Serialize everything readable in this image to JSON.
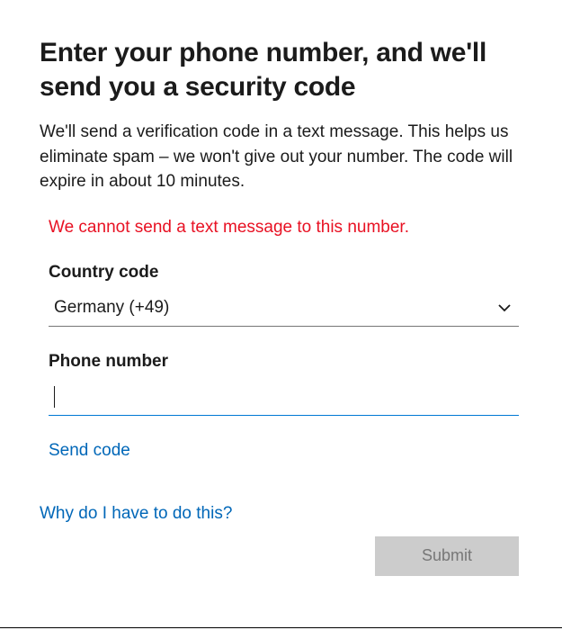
{
  "heading": "Enter your phone number, and we'll send you a security code",
  "subtitle": "We'll send a verification code in a text message. This helps us eliminate spam – we won't give out your number. The code will expire in about 10 minutes.",
  "error_message": "We cannot send a text message to this number.",
  "country_code": {
    "label": "Country code",
    "selected": "Germany (+49)"
  },
  "phone_number": {
    "label": "Phone number",
    "value": ""
  },
  "send_code_label": "Send code",
  "why_link_label": "Why do I have to do this?",
  "submit_label": "Submit",
  "colors": {
    "error": "#e81123",
    "link": "#0067b8",
    "input_active_border": "#0078d4",
    "disabled_bg": "#cccccc",
    "disabled_text": "#777777"
  }
}
